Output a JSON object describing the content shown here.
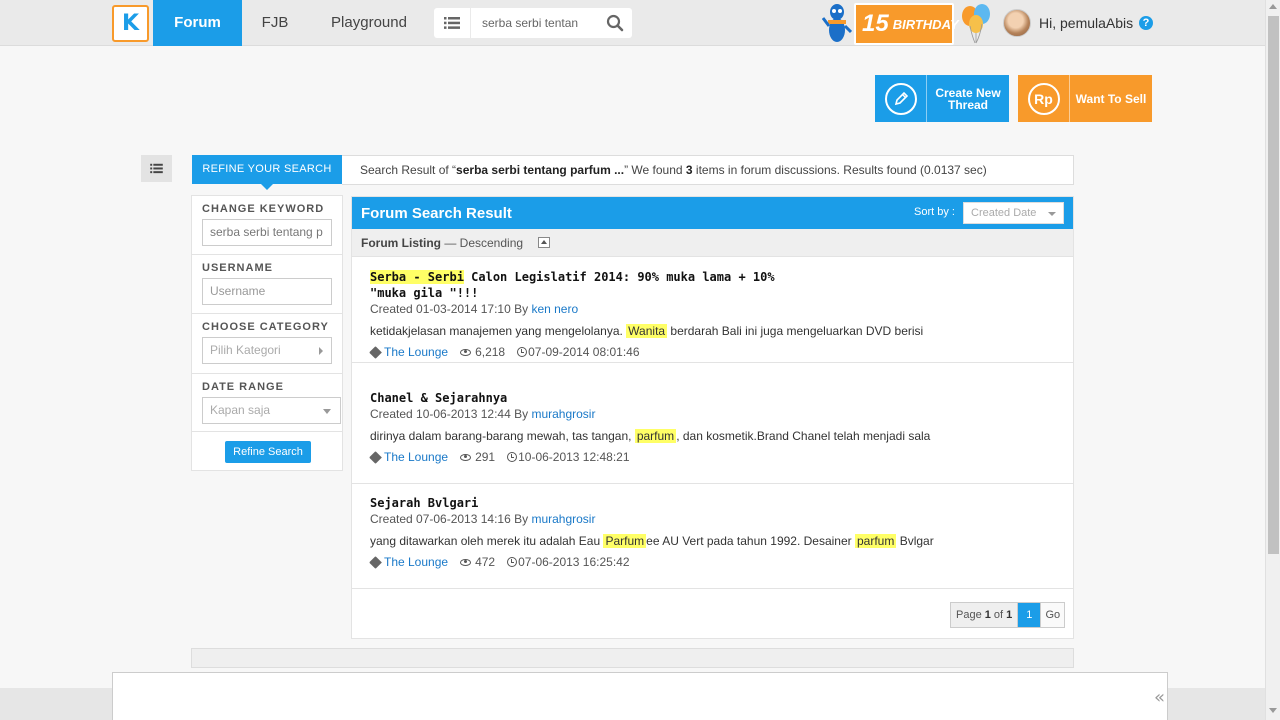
{
  "nav": {
    "logo_letter": "K",
    "tabs": [
      "Forum",
      "FJB",
      "Playground"
    ],
    "search_value": "serba serbi tentan",
    "birthday_num": "15",
    "birthday_text": "BIRTHDAY",
    "greeting": "Hi, pemulaAbis",
    "help": "?"
  },
  "actions": {
    "create_label": "Create New Thread",
    "sell_label": "Want To Sell",
    "sell_icon_text": "Rp"
  },
  "refine": {
    "tab_label": "REFINE YOUR SEARCH",
    "result_prefix": "Search Result of “",
    "result_query": "serba serbi tentang parfum ...",
    "result_mid": "” We found ",
    "result_count": "3",
    "result_suffix": " items in forum discussions. Results found (0.0137 sec)"
  },
  "sidebar": {
    "keyword_label": "CHANGE KEYWORD",
    "keyword_value": "serba serbi tentang p",
    "username_label": "USERNAME",
    "username_placeholder": "Username",
    "category_label": "CHOOSE CATEGORY",
    "category_value": "Pilih Kategori",
    "daterange_label": "DATE RANGE",
    "daterange_value": "Kapan saja",
    "refine_button": "Refine Search"
  },
  "panel": {
    "title": "Forum Search Result",
    "sort_label": "Sort by :",
    "sort_value": "Created Date",
    "listing_label": "Forum Listing",
    "listing_order": " — Descending"
  },
  "items": [
    {
      "title_hl": "Serba - Serbi",
      "title_rest": " Calon Legislatif 2014: 90% muka lama + 10% \"muka gila \"!!!",
      "created": "Created 01-03-2014 17:10 By ",
      "user": "ken nero",
      "snip_pre": "ketidakjelasan manajemen yang mengelolanya. ",
      "snip_hl": "Wanita",
      "snip_post": " berdarah Bali ini juga mengeluarkan DVD berisi",
      "snip_hl2": "",
      "snip_post2": "",
      "category": "The Lounge",
      "views": "6,218",
      "last": "07-09-2014 08:01:46"
    },
    {
      "title_hl": "",
      "title_rest": "Chanel & Sejarahnya",
      "created": "Created 10-06-2013 12:44 By ",
      "user": "murahgrosir",
      "snip_pre": "dirinya dalam barang-barang mewah, tas tangan, ",
      "snip_hl": "parfum",
      "snip_post": ", dan kosmetik.Brand Chanel telah menjadi sala",
      "snip_hl2": "",
      "snip_post2": "",
      "category": "The Lounge",
      "views": "291",
      "last": "10-06-2013 12:48:21"
    },
    {
      "title_hl": "",
      "title_rest": "Sejarah Bvlgari",
      "created": "Created 07-06-2013 14:16 By ",
      "user": "murahgrosir",
      "snip_pre": "yang ditawarkan oleh merek itu adalah Eau ",
      "snip_hl": "Parfum",
      "snip_post": "ee AU Vert pada tahun 1992. Desainer ",
      "snip_hl2": "parfum",
      "snip_post2": " Bvlgar",
      "category": "The Lounge",
      "views": "472",
      "last": "07-06-2013 16:25:42"
    }
  ],
  "pager": {
    "info_pre": "Page ",
    "info_cur": "1",
    "info_of": " of ",
    "info_total": "1",
    "current": "1",
    "go": "Go"
  },
  "colors": {
    "primary": "#1b9de8",
    "accent": "#f89a2b",
    "highlight": "#ffff66"
  },
  "bottom_chevron": "«"
}
